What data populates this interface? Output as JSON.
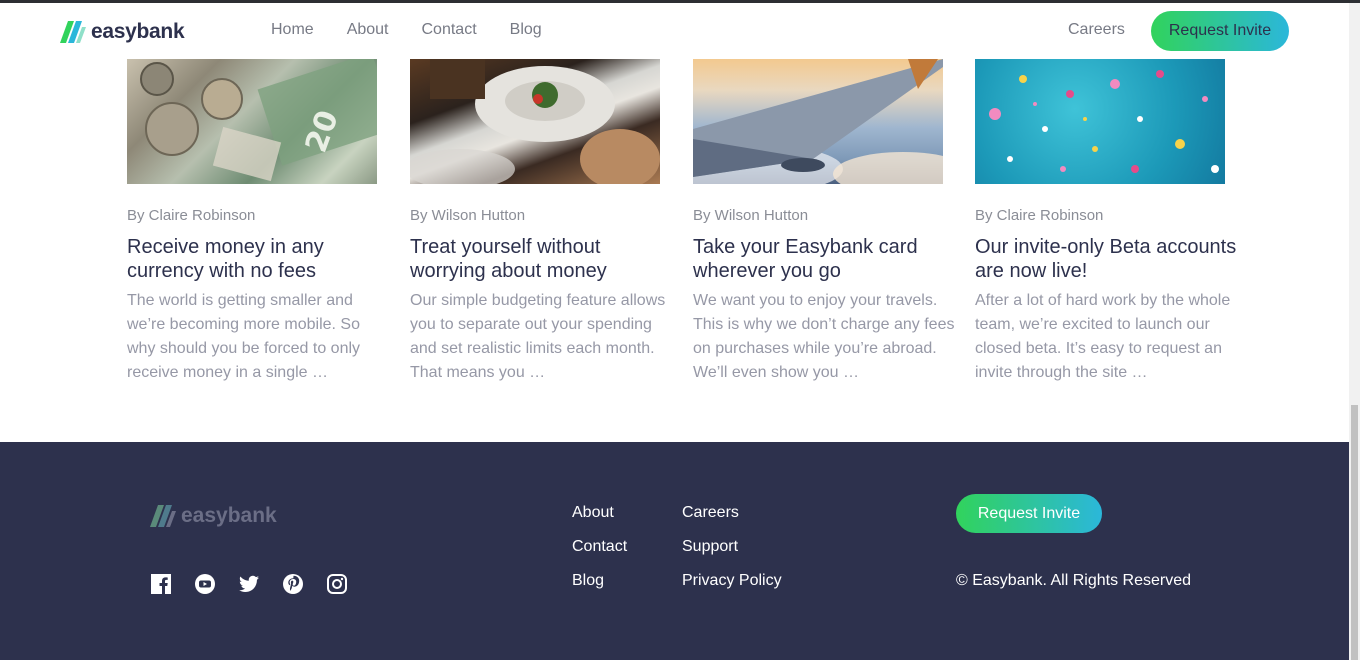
{
  "brand": {
    "name": "easybank"
  },
  "nav": {
    "items": [
      "Home",
      "About",
      "Contact",
      "Blog"
    ],
    "careers": "Careers",
    "cta": "Request Invite"
  },
  "articles": [
    {
      "author": "By Claire Robinson",
      "title": "Receive money in any currency with no fees",
      "excerpt": "The world is getting smaller and we’re becoming more mobile. So why should you be forced to only receive money in a single …",
      "image": "currency-image"
    },
    {
      "author": "By Wilson Hutton",
      "title": "Treat yourself without worrying about money",
      "excerpt": "Our simple budgeting feature allows you to separate out your spending and set realistic limits each month. That means you …",
      "image": "restaurant-image"
    },
    {
      "author": "By Wilson Hutton",
      "title": "Take your Easybank card wherever you go",
      "excerpt": "We want you to enjoy your travels. This is why we don’t charge any fees on purchases while you’re abroad. We’ll even show you …",
      "image": "plane-image"
    },
    {
      "author": "By Claire Robinson",
      "title": "Our invite-only Beta accounts are now live!",
      "excerpt": "After a lot of hard work by the whole team, we’re excited to launch our closed beta. It’s easy to request an invite through the site …",
      "image": "confetti-image"
    }
  ],
  "footer": {
    "brand": "easybank",
    "socials": [
      "facebook-icon",
      "youtube-icon",
      "twitter-icon",
      "pinterest-icon",
      "instagram-icon"
    ],
    "links_col1": [
      "About",
      "Contact",
      "Blog"
    ],
    "links_col2": [
      "Careers",
      "Support",
      "Privacy Policy"
    ],
    "cta": "Request Invite",
    "copyright": "© Easybank. All Rights Reserved"
  },
  "colors": {
    "dark_blue": "#2d314d",
    "lime_green": "#31d35c",
    "bright_cyan": "#2bb7da",
    "grayish_blue": "#9698a6"
  }
}
